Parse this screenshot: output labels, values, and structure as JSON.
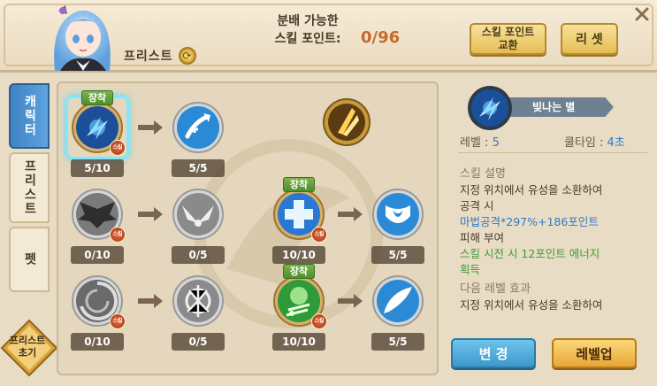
{
  "header": {
    "character_name": "프리스트",
    "points_label_line1": "분배 가능한",
    "points_label_line2": "스킬 포인트:",
    "points_value": "0/96",
    "exchange_button_line1": "스킬 포인트",
    "exchange_button_line2": "교환",
    "reset_button": "리 셋"
  },
  "tabs": [
    {
      "label": "캐릭터",
      "active": true
    },
    {
      "label": "프리스트",
      "active": false
    },
    {
      "label": "펫",
      "active": false
    }
  ],
  "reinit_badge": {
    "line1": "프리스트",
    "line2": "초기"
  },
  "skills": {
    "equip_label": "장착",
    "skill_badge_label": "스킬",
    "r1c1": {
      "level": "5/10",
      "equipped": true,
      "selected": true,
      "icon": "starfall-icon"
    },
    "r1c2": {
      "level": "5/5",
      "icon": "heal-arrow-icon"
    },
    "r1c3": {
      "icon": "golden-light-icon"
    },
    "r2c1": {
      "level": "0/10",
      "icon": "dark-wings-icon"
    },
    "r2c2": {
      "level": "0/5",
      "icon": "wings-icon"
    },
    "r2c3": {
      "level": "10/10",
      "equipped": true,
      "icon": "holy-cross-icon"
    },
    "r2c4": {
      "level": "5/5",
      "icon": "heart-shield-icon"
    },
    "r3c1": {
      "level": "0/10",
      "icon": "vortex-icon"
    },
    "r3c2": {
      "level": "0/5",
      "icon": "radiance-icon"
    },
    "r3c3": {
      "level": "10/10",
      "equipped": true,
      "icon": "green-song-icon"
    },
    "r3c4": {
      "level": "5/5",
      "icon": "feather-icon"
    }
  },
  "detail": {
    "name": "빛나는 별",
    "level_label": "레벨 : ",
    "level_value": "5",
    "cooldown_label": "쿨타임 : ",
    "cooldown_value": "4초",
    "desc_title": "스킬 설명",
    "desc_line1": "지정 위치에서 유성을 소환하여",
    "desc_line2": "공격 시",
    "desc_line3": "마법공격*297%+186포인트",
    "desc_line4": "피해 부여",
    "desc_line5": "스킬 시전 시 12포인트 에너지",
    "desc_line6": "획득",
    "next_title": "다음 레벨 효과",
    "next_line1": "지정 위치에서 유성을 소환하여",
    "change_button": "변 경",
    "levelup_button": "레벨업"
  },
  "colors": {
    "accent_blue": "#2f7bc4",
    "accent_green": "#3f9a3a",
    "points_orange": "#c8682b",
    "equip_green": "#5f9a36"
  }
}
